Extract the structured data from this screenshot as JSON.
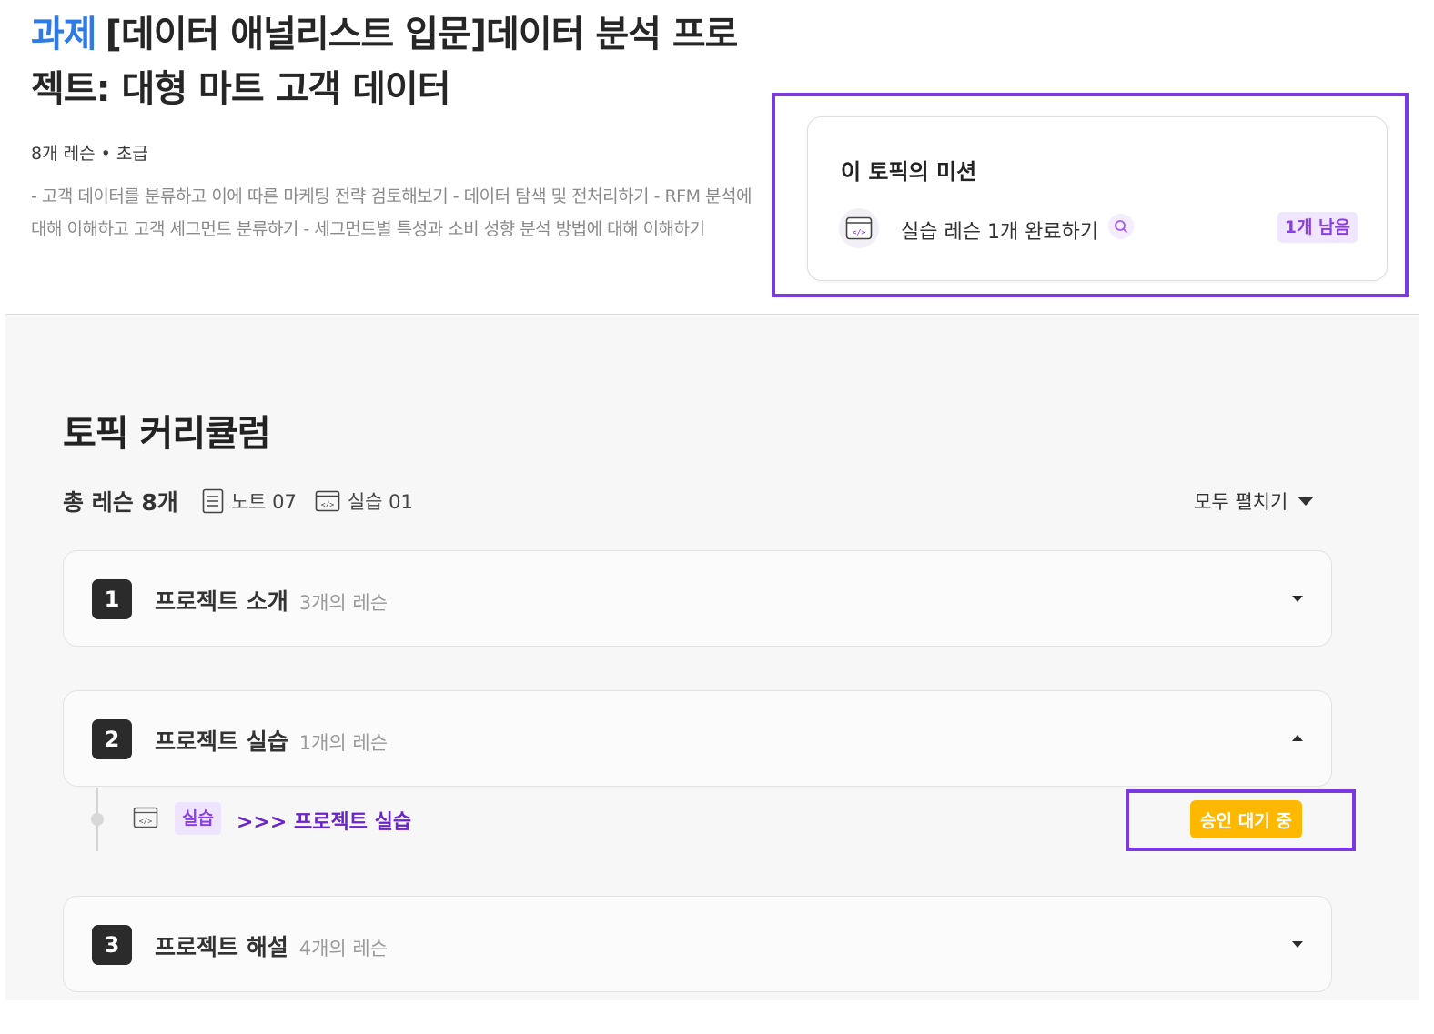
{
  "topic": {
    "tag": "과제",
    "title": "[데이터 애널리스트 입문]데이터 분석 프로젝트: 대형 마트 고객 데이터",
    "meta": "8개 레슨 • 초급",
    "description": "- 고객 데이터를 분류하고 이에 따른 마케팅 전략 검토해보기 - 데이터 탐색 및 전처리하기 - RFM 분석에 대해 이해하고 고객 세그먼트 분류하기 - 세그먼트별 특성과 소비 성향 분석 방법에 대해 이해하기"
  },
  "mission": {
    "title": "이 토픽의 미션",
    "item_label": "실습 레슨 1개 완료하기",
    "remaining": "1개 남음",
    "icon": "code-window-icon"
  },
  "curriculum": {
    "title": "토픽 커리큘럼",
    "total": "총 레슨 8개",
    "notes": "노트 07",
    "practice": "실습 01",
    "expand_all": "모두 펼치기",
    "sections": [
      {
        "num": "1",
        "title": "프로젝트 소개",
        "count": "3개의 레슨",
        "expanded": false
      },
      {
        "num": "2",
        "title": "프로젝트 실습",
        "count": "1개의 레슨",
        "expanded": true
      },
      {
        "num": "3",
        "title": "프로젝트 해설",
        "count": "4개의 레슨",
        "expanded": false
      }
    ],
    "lesson": {
      "badge": "실습",
      "title": ">>> 프로젝트 실습",
      "status": "승인 대기 중"
    }
  },
  "colors": {
    "accent_purple": "#7a3ae0",
    "tag_blue": "#2f7be6",
    "status_yellow": "#ffb800"
  }
}
